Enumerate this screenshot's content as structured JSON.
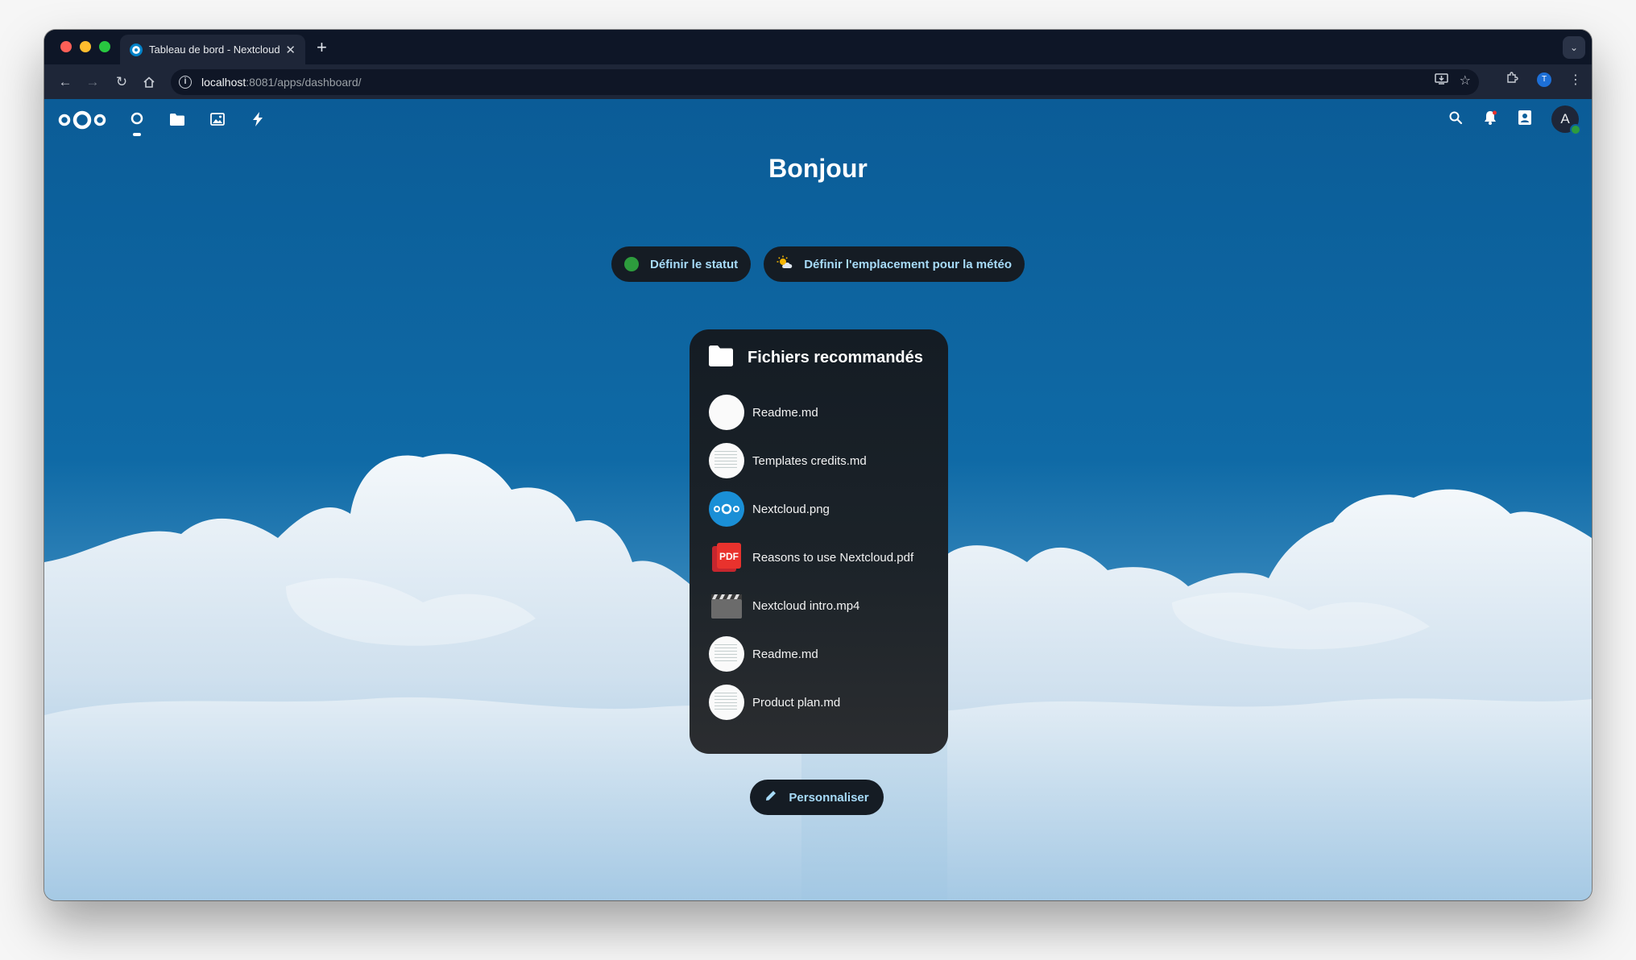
{
  "browser": {
    "tab_title": "Tableau de bord - Nextcloud",
    "url_host": "localhost",
    "url_rest": ":8081/apps/dashboard/",
    "profile_initial": "T"
  },
  "header": {
    "apps": [
      "dashboard-icon",
      "files-icon",
      "photos-icon",
      "activity-icon"
    ],
    "avatar_initial": "A",
    "status_color": "#2d9c3d"
  },
  "dashboard": {
    "greeting": "Bonjour",
    "set_status_label": "Définir le statut",
    "set_weather_label": "Définir l'emplacement pour la météo",
    "customize_label": "Personnaliser"
  },
  "widget": {
    "title": "Fichiers recommandés",
    "files": [
      {
        "name": "Readme.md",
        "thumb": "blank"
      },
      {
        "name": "Templates credits.md",
        "thumb": "doc"
      },
      {
        "name": "Nextcloud.png",
        "thumb": "nc"
      },
      {
        "name": "Reasons to use Nextcloud.pdf",
        "thumb": "pdf"
      },
      {
        "name": "Nextcloud intro.mp4",
        "thumb": "vid"
      },
      {
        "name": "Readme.md",
        "thumb": "doc"
      },
      {
        "name": "Product plan.md",
        "thumb": "doc"
      }
    ]
  },
  "colors": {
    "accent_text": "#a7dbf8",
    "pill_bg": "#151c24",
    "sky": "#0b5c97"
  }
}
